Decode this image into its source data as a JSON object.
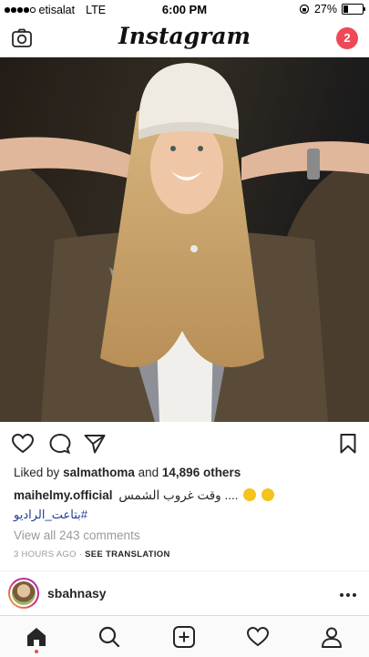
{
  "status_bar": {
    "carrier": "etisalat",
    "network": "LTE",
    "time": "6:00 PM",
    "battery": "27%",
    "battery_level": 0.27
  },
  "header": {
    "logo": "Instagram",
    "notification_count": "2",
    "camera_icon": "camera-icon"
  },
  "post": {
    "likes_prefix": "Liked by",
    "liked_by_user": "salmathoma",
    "likes_and": "and",
    "likes_count": "14,896 others",
    "caption_user": "maihelmy.official",
    "caption_text": "وقت غروب الشمس ....",
    "hashtag": "#بتاعت_الراديو",
    "view_comments": "View all 243 comments",
    "time_ago": "3 HOURS AGO",
    "separator": "·",
    "see_translation": "SEE TRANSLATION",
    "icons": [
      "heart-icon",
      "comment-icon",
      "share-icon",
      "bookmark-icon"
    ]
  },
  "next_post": {
    "username": "sbahnasy"
  },
  "tab_bar": {
    "items": [
      "home-icon",
      "search-icon",
      "add-icon",
      "activity-icon",
      "profile-icon"
    ]
  }
}
